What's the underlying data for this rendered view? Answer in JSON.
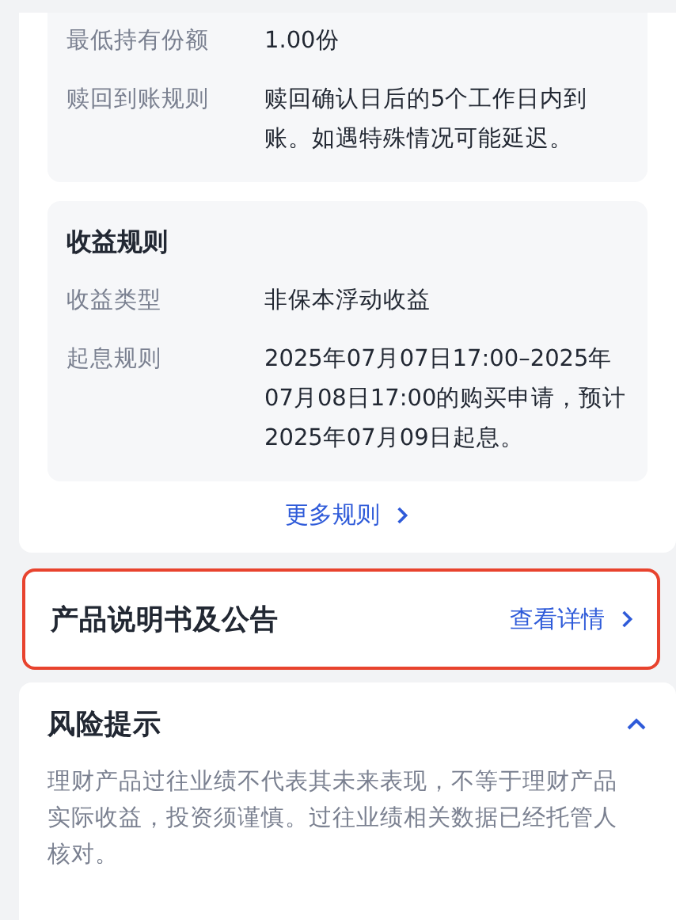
{
  "rules_card": {
    "groups": [
      {
        "rows": [
          {
            "label": "最低持有份额",
            "value": "1.00份"
          },
          {
            "label": "赎回到账规则",
            "value": "赎回确认日后的5个工作日内到账。如遇特殊情况可能延迟。"
          }
        ]
      },
      {
        "title": "收益规则",
        "rows": [
          {
            "label": "收益类型",
            "value": "非保本浮动收益"
          },
          {
            "label": "起息规则",
            "value": "2025年07月07日17:00–2025年07月08日17:00的购买申请，预计2025年07月09日起息。"
          }
        ]
      }
    ],
    "more_link": "更多规则"
  },
  "documents": {
    "title": "产品说明书及公告",
    "link": "查看详情",
    "highlighted": true
  },
  "risk": {
    "title": "风险提示",
    "expanded": true,
    "text": "理财产品过往业绩不代表其未来表现，不等于理财产品实际收益，投资须谨慎。过往业绩相关数据已经托管人核对。"
  }
}
